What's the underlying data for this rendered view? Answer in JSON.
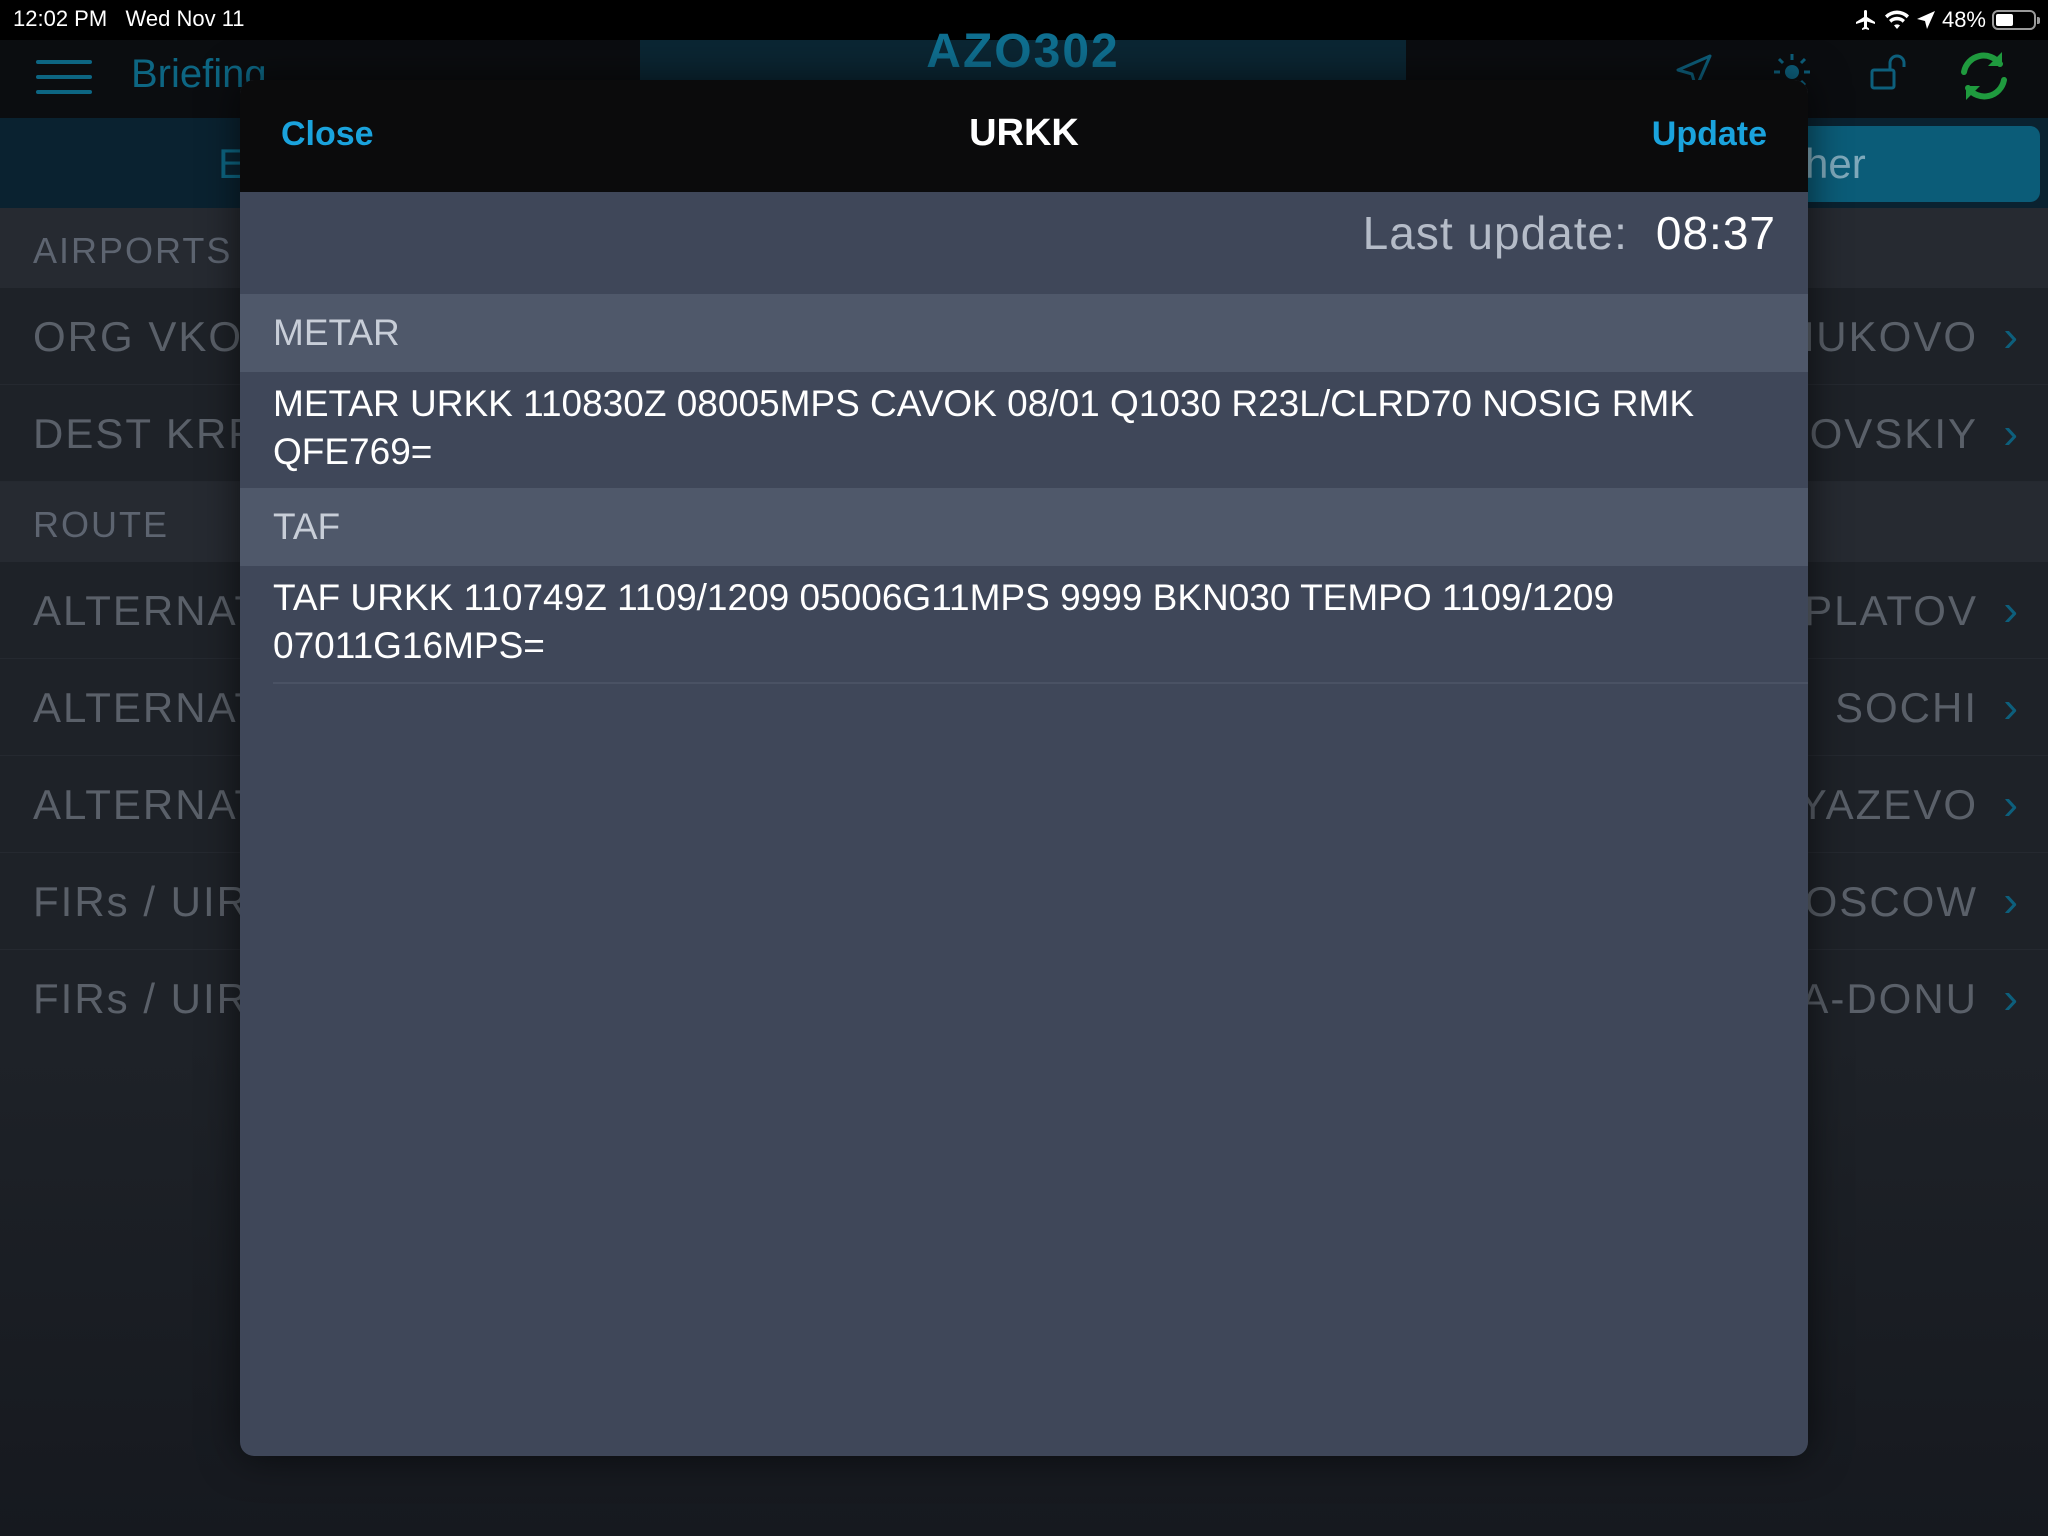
{
  "status_bar": {
    "time": "12:02 PM",
    "date": "Wed Nov 11",
    "battery": "48%",
    "battery_level": 0.48,
    "icons": [
      "airplane-mode-icon",
      "wifi-icon",
      "location-icon",
      "battery-icon"
    ]
  },
  "app": {
    "flight_number": "AZO302",
    "nav_back_label": "Briefing",
    "nav_icons": [
      "navigation-icon",
      "brightness-icon",
      "unlock-icon",
      "refresh-icon"
    ],
    "segment_left": "E",
    "segment_right": "her"
  },
  "background_list": {
    "airports_header": "AIRPORTS",
    "route_header": "ROUTE",
    "rows": [
      {
        "label": "ORG  VKO",
        "value": "NUKOVO"
      },
      {
        "label": "DEST  KRR",
        "value": "KOVSKIY"
      }
    ],
    "route_rows": [
      {
        "label": "ALTERNAT",
        "value": "PLATOV"
      },
      {
        "label": "ALTERNAT",
        "value": "SOCHI"
      },
      {
        "label": "ALTERNAT",
        "value": "YAZEVO"
      },
      {
        "label": "FIRs / UIRs",
        "value": "OSCOW"
      },
      {
        "label": "FIRs / UIRs",
        "value": "A-DONU"
      }
    ]
  },
  "modal": {
    "title": "URKK",
    "close_label": "Close",
    "update_label": "Update",
    "last_update_label": "Last update:",
    "last_update_value": "08:37",
    "metar_header": "METAR",
    "metar_text": "METAR URKK 110830Z 08005MPS CAVOK 08/01 Q1030 R23L/CLRD70 NOSIG RMK QFE769=",
    "taf_header": "TAF",
    "taf_text": "TAF URKK 110749Z 1109/1209 05006G11MPS 9999 BKN030 TEMPO 1109/1209 07011G16MPS="
  },
  "colors": {
    "accent": "#1aa3dd",
    "refresh_green": "#1f9a3e",
    "modal_bg": "#3f4759",
    "section_header_bg": "#4f586a"
  }
}
